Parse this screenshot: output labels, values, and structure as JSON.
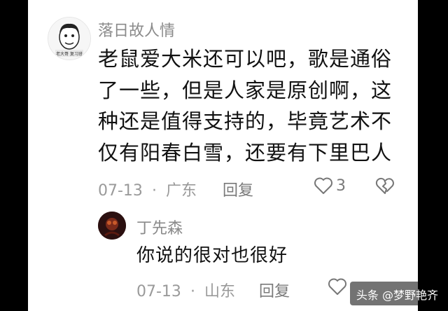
{
  "comment": {
    "username": "落日故人情",
    "avatar_caption": "老大哥 复习班",
    "text": "老鼠爱大米还可以吧，歌是通俗了一些，但是人家是原创啊，这种还是值得支持的，毕竟艺术不仅有阳春白雪，还要有下里巴人",
    "date": "07-13",
    "separator": "·",
    "location": "广东",
    "reply_label": "回复",
    "like_count": "3"
  },
  "reply": {
    "username": "丁先森",
    "text": "你说的很对也很好",
    "date": "07-13",
    "separator": "·",
    "location": "山东",
    "reply_label": "回复"
  },
  "watermark": "头条 @梦野艳齐",
  "icons": [
    "like-icon",
    "dislike-icon"
  ]
}
